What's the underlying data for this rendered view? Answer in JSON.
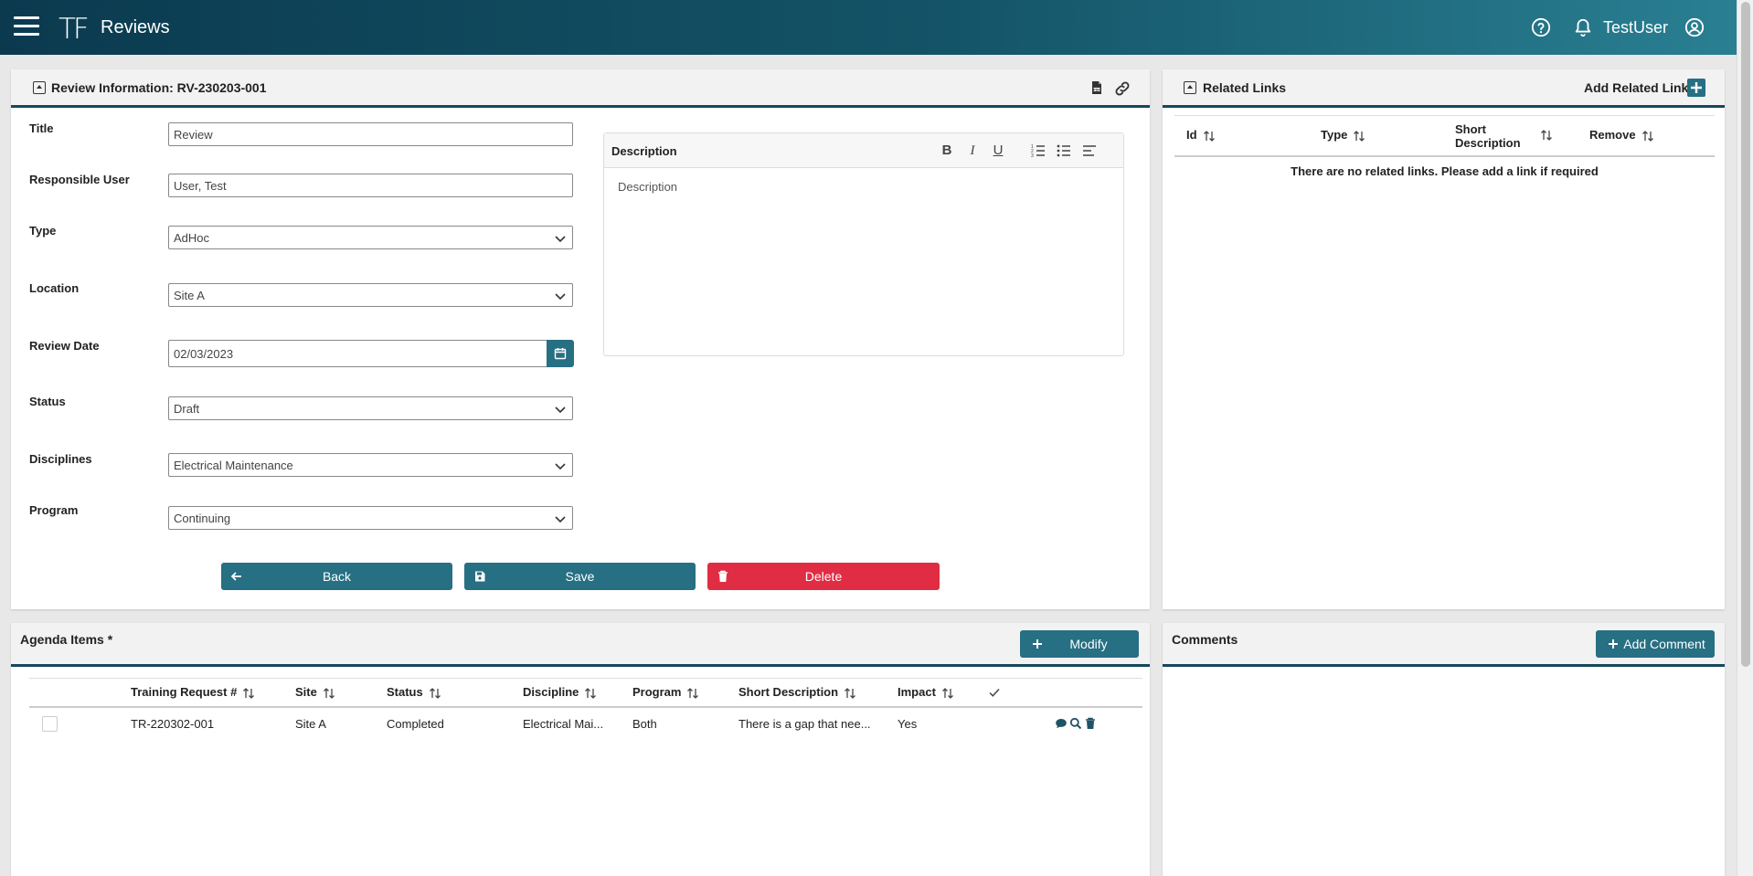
{
  "header": {
    "logo": "TF",
    "app_title": "Reviews",
    "username": "TestUser"
  },
  "review": {
    "title": "Review Information: RV-230203-001",
    "fields": {
      "title_label": "Title",
      "title_value": "Review",
      "responsible_label": "Responsible User",
      "responsible_value": "User, Test",
      "type_label": "Type",
      "type_value": "AdHoc",
      "location_label": "Location",
      "location_value": "Site A",
      "date_label": "Review Date",
      "date_value": "02/03/2023",
      "status_label": "Status",
      "status_value": "Draft",
      "disciplines_label": "Disciplines",
      "disciplines_value": "Electrical Maintenance",
      "program_label": "Program",
      "program_value": "Continuing"
    },
    "description": {
      "label": "Description",
      "placeholder": "Description"
    },
    "buttons": {
      "back": "Back",
      "save": "Save",
      "delete": "Delete"
    }
  },
  "related_links": {
    "title": "Related Links",
    "add_label": "Add Related Link",
    "columns": [
      "Id",
      "Type",
      "Short\nDescription",
      "Remove"
    ],
    "col_short_1": "Short",
    "col_short_2": "Description",
    "empty_message": "There are no related links. Please add a link if required"
  },
  "agenda": {
    "title": "Agenda Items *",
    "modify_label": "Modify",
    "columns": {
      "training_request": "Training Request #",
      "site": "Site",
      "status": "Status",
      "discipline": "Discipline",
      "program": "Program",
      "short_description": "Short Description",
      "impact": "Impact"
    },
    "rows": [
      {
        "training_request": "TR-220302-001",
        "site": "Site A",
        "status": "Completed",
        "discipline": "Electrical Mai...",
        "program": "Both",
        "short_description": "There is a gap that nee...",
        "impact": "Yes"
      }
    ]
  },
  "comments": {
    "title": "Comments",
    "add_label": "Add Comment"
  },
  "colors": {
    "header_dark": "#0b3a4f",
    "accent_teal": "#276f82",
    "danger": "#e02d43"
  }
}
